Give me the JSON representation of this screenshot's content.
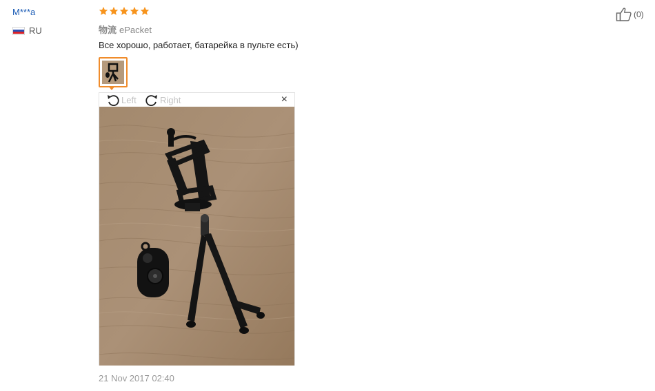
{
  "reviewer": {
    "name": "M***a",
    "country": "RU",
    "flag_colors": [
      "#ffffff",
      "#2b4fb3",
      "#d8232a"
    ]
  },
  "rating": {
    "stars": 5,
    "max": 5,
    "color": "#f7941d"
  },
  "shipping": {
    "label": "物流",
    "method": "ePacket"
  },
  "review_text": "Все хорошо, работает, батарейка в пульте есть)",
  "photo_viewer": {
    "rotate_left_label": "Left",
    "rotate_right_label": "Right",
    "close_symbol": "×",
    "accent": "#f08c2b",
    "icons": [
      "rotate-left-icon",
      "rotate-right-icon",
      "close-icon"
    ]
  },
  "helpful": {
    "icon": "thumbs-up-icon",
    "count_label": "(0)"
  },
  "date": "21 Nov 2017 02:40"
}
